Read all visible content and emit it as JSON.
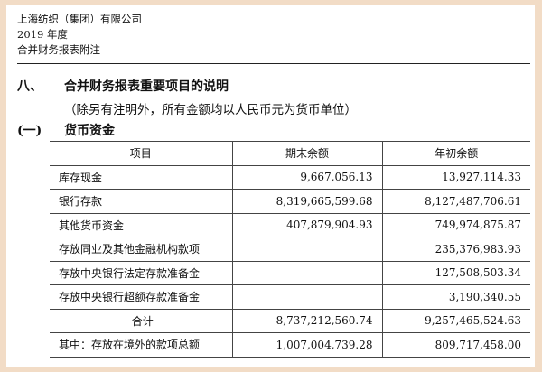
{
  "header": {
    "company": "上海纺织（集团）有限公司",
    "year": "2019 年度",
    "doc_title": "合并财务报表附注"
  },
  "section": {
    "number": "八、",
    "title": "合并财务报表重要项目的说明",
    "note": "（除另有注明外，所有金额均以人民币元为货币单位）"
  },
  "subsection": {
    "number": "(一)",
    "title": "货币资金"
  },
  "table": {
    "headers": [
      "项目",
      "期末余额",
      "年初余额"
    ],
    "rows": [
      {
        "item": "库存现金",
        "end": "9,667,056.13",
        "begin": "13,927,114.33"
      },
      {
        "item": "银行存款",
        "end": "8,319,665,599.68",
        "begin": "8,127,487,706.61"
      },
      {
        "item": "其他货币资金",
        "end": "407,879,904.93",
        "begin": "749,974,875.87"
      },
      {
        "item": "存放同业及其他金融机构款项",
        "end": "",
        "begin": "235,376,983.93"
      },
      {
        "item": "存放中央银行法定存款准备金",
        "end": "",
        "begin": "127,508,503.34"
      },
      {
        "item": "存放中央银行超额存款准备金",
        "end": "",
        "begin": "3,190,340.55"
      }
    ],
    "total": {
      "item": "合计",
      "end": "8,737,212,560.74",
      "begin": "9,257,465,524.63"
    },
    "overseas": {
      "item": "其中：存放在境外的款项总额",
      "end": "1,007,004,739.28",
      "begin": "809,717,458.00"
    }
  }
}
